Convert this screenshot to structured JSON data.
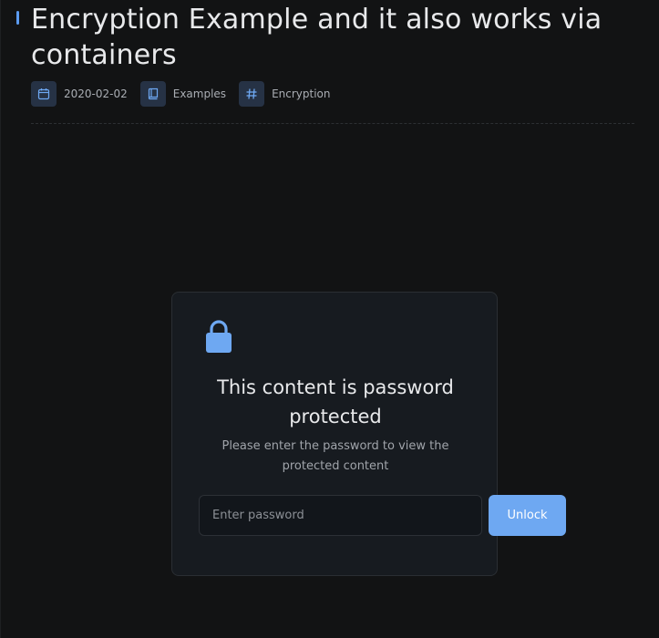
{
  "post": {
    "title": "Encryption Example and it also works via containers",
    "meta": {
      "date": "2020-02-02",
      "category": "Examples",
      "tag": "Encryption"
    }
  },
  "protected": {
    "title": "This content is password protected",
    "description": "Please enter the password to view the protected content",
    "password_placeholder": "Enter password",
    "unlock_label": "Unlock"
  },
  "icons": {
    "date": "calendar-icon",
    "category": "book-icon",
    "tag": "hash-icon",
    "lock": "lock-icon"
  },
  "colors": {
    "background": "#121314",
    "card": "#171b20",
    "accent": "#6ea8f2",
    "icon_bg": "#263245"
  }
}
